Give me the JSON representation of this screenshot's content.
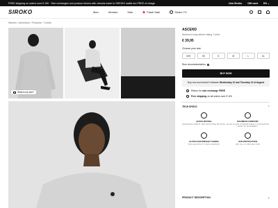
{
  "topbar": {
    "promo": "FREE shipping on orders over € 100 · Size exchanges and product returns with refunds made to SIROKO wallet are FREE of charge",
    "join": "Join Siroko",
    "gift": "Gift card",
    "lang": "EN"
  },
  "nav": {
    "logo": "SIROKO",
    "items": [
      "Men",
      "Women",
      "Kids",
      "Flash Sale",
      "Siroko TV"
    ]
  },
  "breadcrumb": "Women / Adventure / Products / T-shirts",
  "gallery": {
    "size_tag": "What is my size?"
  },
  "product": {
    "name": "ASCEND",
    "desc": "Women's long sleeve hiking T-shirt",
    "price": "€ 39,95",
    "choose_size": "Choose your size",
    "sizes": [
      "XXS",
      "XS",
      "S",
      "M",
      "L",
      "XL"
    ],
    "size_rec": "Size recommendation",
    "buy": "BUY NOW",
    "delivery": "Buy now and receive it between",
    "delivery_dates": "Wednesday 12 and Thursday 13 of August",
    "return_prefix": "Return for",
    "return_bold": "size exchange FREE",
    "shipping_bold": "Free shipping",
    "shipping_suffix": "on all orders over € 100"
  },
  "tech": {
    "title": "TECH SPECS",
    "specs": [
      {
        "title": "QUICK-DRYING",
        "desc": "ENHANCES SWEAT AND MOISTURE WICKING"
      },
      {
        "title": "MAXIMUM COMFORT",
        "desc": "ELASTIC AND COMFORTABLE FIT ENSURING EASE OF MOVEMENT"
      },
      {
        "title": "ULTRALIGHTWEIGHT FABRIC",
        "desc": "HIGH ELASTICITY AND COMFORT"
      },
      {
        "title": "SUN PROTECTION",
        "desc": "UPF 50+ UV PROTECTION"
      }
    ]
  },
  "desc_section": "PRODUCT DESCRIPTION"
}
